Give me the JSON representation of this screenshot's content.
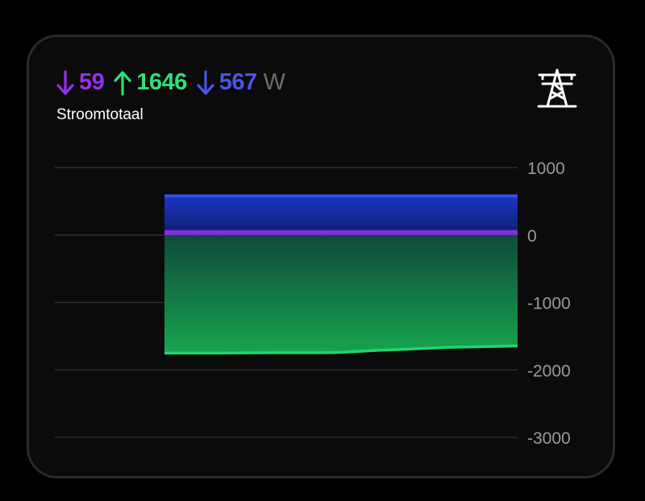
{
  "card": {
    "title": "Stroomtotaal",
    "unit": "W",
    "icon": "power-tower-icon",
    "metrics": [
      {
        "direction": "down",
        "value": "59",
        "color": "#9b2df2"
      },
      {
        "direction": "up",
        "value": "1646",
        "color": "#2ee07a"
      },
      {
        "direction": "down",
        "value": "567",
        "color": "#4a55e8"
      }
    ]
  },
  "chart_data": {
    "type": "area",
    "y_ticks": [
      "1000",
      "0",
      "-1000",
      "-2000",
      "-3000"
    ],
    "ylim": [
      -3000,
      1000
    ],
    "grid": true,
    "series": [
      {
        "color": "#3b4ff0",
        "x": [
          0,
          0.25,
          0.5,
          0.75,
          1.0
        ],
        "values": [
          580,
          580,
          580,
          580,
          580
        ]
      },
      {
        "color": "#8a2be2",
        "x": [
          0,
          0.25,
          0.5,
          0.75,
          1.0
        ],
        "values": [
          59,
          59,
          59,
          59,
          59
        ]
      },
      {
        "color": "#22d46e",
        "x": [
          0,
          0.15,
          0.3,
          0.45,
          0.5,
          0.6,
          0.7,
          0.8,
          0.9,
          1.0
        ],
        "values": [
          -1750,
          -1750,
          -1745,
          -1745,
          -1740,
          -1710,
          -1690,
          -1665,
          -1655,
          -1645
        ]
      }
    ]
  }
}
